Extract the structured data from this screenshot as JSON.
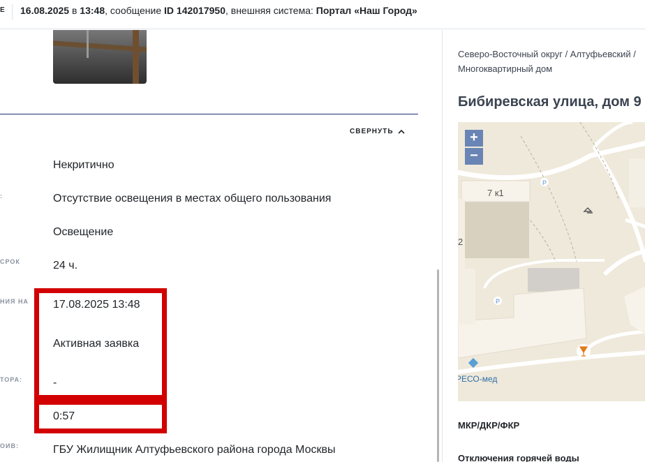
{
  "header": {
    "cut_label": "Е",
    "date": "16.08.2025",
    "in_word": " в ",
    "time": "13:48",
    "message_prefix": ", сообщение ",
    "message_id": "ID 142017950",
    "system_prefix": ", внешняя система: ",
    "system_name": "Портал «Наш Город»"
  },
  "details": {
    "collapse_label": "СВЕРНУТЬ",
    "rows": [
      {
        "label": "",
        "value": "Некритично"
      },
      {
        "label": ":",
        "value": "Отсутствие освещения в местах общего пользования"
      },
      {
        "label": "",
        "value": "Освещение"
      },
      {
        "label": "СРОК",
        "value": "24 ч."
      },
      {
        "label": "НИЯ НА",
        "value": "17.08.2025 13:48"
      },
      {
        "label": "",
        "value": "Активная заявка"
      },
      {
        "label": "ТОРА:",
        "value": "-"
      },
      {
        "label": "",
        "value": "0:57"
      },
      {
        "label": "ОИВ:",
        "value": "ГБУ Жилищник Алтуфьевского района города Москвы"
      }
    ]
  },
  "sidebar": {
    "breadcrumb": "Северо-Восточный округ / Алтуфьевский / Многоквартирный дом",
    "address": "Бибиревская улица, дом 9",
    "map": {
      "zoom_in": "+",
      "zoom_out": "−",
      "building_label": "7 к1",
      "edge_label": "2",
      "poi_label": "РЕСО-мед",
      "parking": "P"
    },
    "section_1": "МКР/ДКР/ФКР",
    "section_2": "Отключения горячей воды"
  },
  "colors": {
    "highlight": "#d20000",
    "divider": "#232f7a",
    "map_zoom": "#6985b5"
  }
}
